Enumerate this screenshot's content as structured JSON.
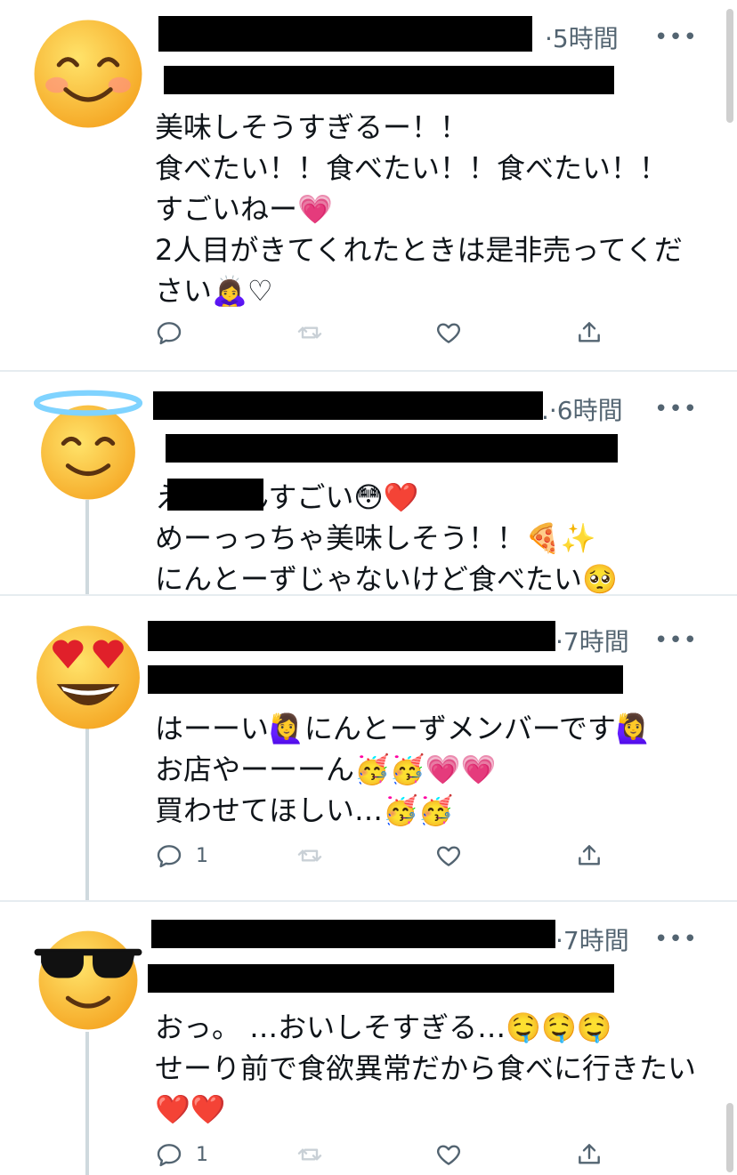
{
  "tweets": [
    {
      "time": "·5時間",
      "lines": [
        "美味しそうすぎるー！！",
        "食べたい！！食べたい！！食べたい！！",
        "すごいねー💗",
        "2人目がきてくれたときは是非売ってくだ",
        "さい🙇‍♀️♡"
      ],
      "reply_count": "",
      "avatar_icon": "smiling-face-with-smiling-eyes-icon"
    },
    {
      "time": ".·6時間",
      "lines": [
        "えちゃんすごい😳❤️",
        "めーっっちゃ美味しそう！！🍕✨",
        "にんとーずじゃないけど食べたい🥺"
      ],
      "reply_count": "",
      "avatar_icon": "halo-face-icon"
    },
    {
      "time": "·7時間",
      "lines": [
        "はーーい🙋‍♀️にんとーずメンバーです🙋‍♀️",
        "お店やーーーん🥳🥳💗💗",
        "買わせてほしい…🥳🥳"
      ],
      "reply_count": "1",
      "avatar_icon": "heart-eyes-face-icon"
    },
    {
      "time": "·7時間",
      "lines": [
        "おっ。 …おいしそすぎる…🤤🤤🤤",
        "せーり前で食欲異常だから食べに行きたい",
        "❤️❤️"
      ],
      "reply_count": "1",
      "avatar_icon": "sunglasses-face-icon"
    }
  ],
  "more_label": "•••",
  "colors": {
    "text": "#0f1419",
    "secondary": "#536471",
    "divider": "#e6ecf0"
  }
}
